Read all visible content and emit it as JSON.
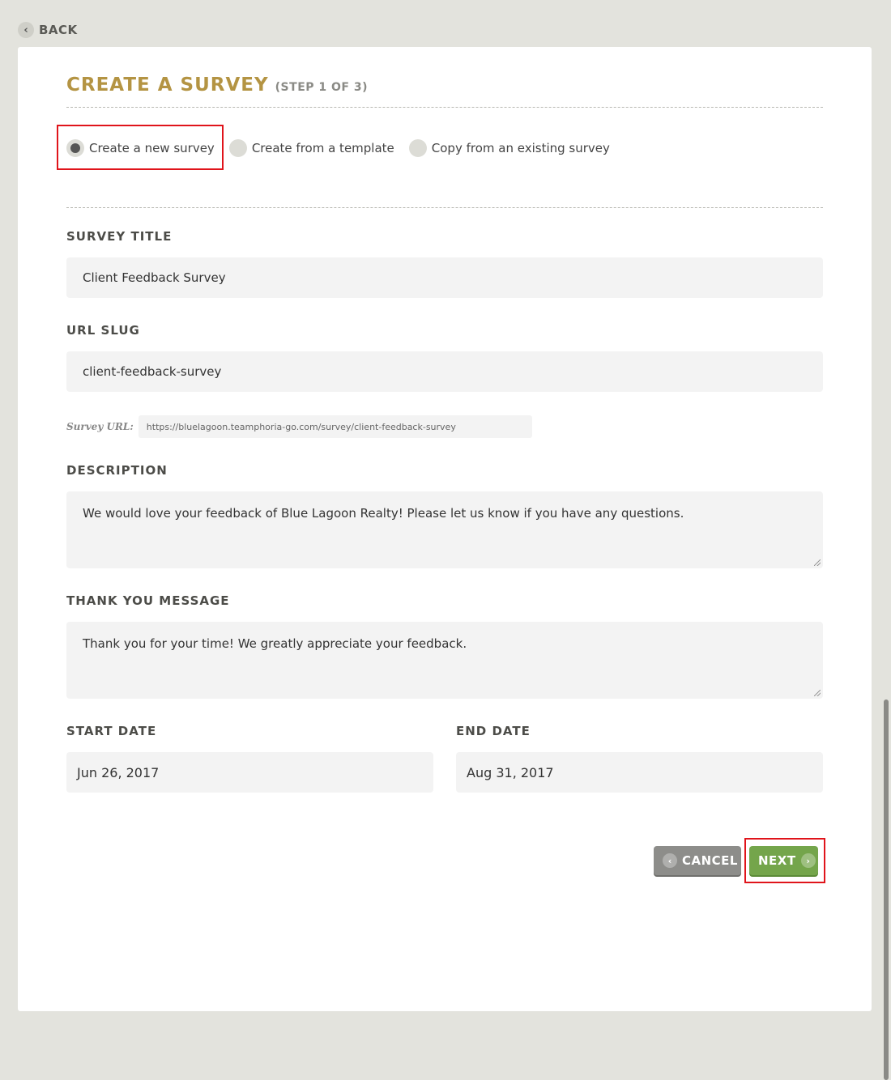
{
  "nav": {
    "back_label": "BACK"
  },
  "form": {
    "title": "CREATE A SURVEY",
    "step": "(STEP 1 OF 3)",
    "options": [
      {
        "label": "Create a new survey",
        "selected": true
      },
      {
        "label": "Create from a template",
        "selected": false
      },
      {
        "label": "Copy from an existing survey",
        "selected": false
      }
    ],
    "survey_title": {
      "label": "SURVEY TITLE",
      "value": "Client Feedback Survey"
    },
    "url_slug": {
      "label": "URL SLUG",
      "value": "client-feedback-survey"
    },
    "survey_url": {
      "label": "Survey URL:",
      "value": "https://bluelagoon.teamphoria-go.com/survey/client-feedback-survey"
    },
    "description": {
      "label": "DESCRIPTION",
      "value": "We would love your feedback of Blue Lagoon Realty! Please let us know if you have any questions."
    },
    "thank_you": {
      "label": "THANK YOU MESSAGE",
      "value": "Thank you for your time! We greatly appreciate your feedback."
    },
    "start_date": {
      "label": "START DATE",
      "value": "Jun 26, 2017"
    },
    "end_date": {
      "label": "END DATE",
      "value": "Aug 31, 2017"
    }
  },
  "actions": {
    "cancel_label": "CANCEL",
    "next_label": "NEXT"
  },
  "colors": {
    "accent": "#b49443",
    "next_button": "#74a54b",
    "cancel_button": "#8d8d8a",
    "highlight": "#e0141b"
  }
}
